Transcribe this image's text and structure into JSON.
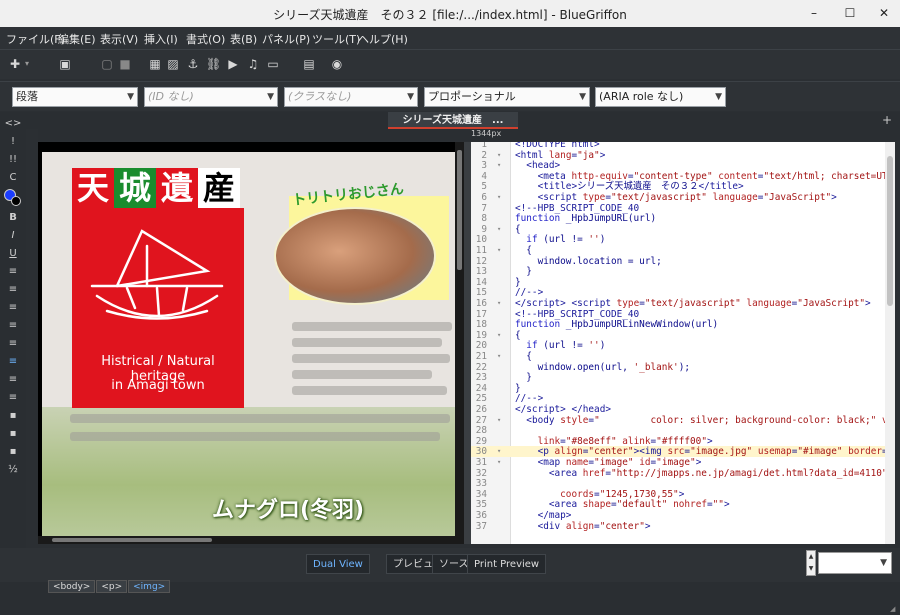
{
  "window": {
    "title": "シリーズ天城遺産　その３２ [file:/.../index.html] - BlueGriffon",
    "minimize": "–",
    "maximize": "☐",
    "close": "✕"
  },
  "menu": [
    "ファイル(F)",
    "編集(E)",
    "表示(V)",
    "挿入(I)",
    "書式(O)",
    "表(B)",
    "パネル(P)",
    "ツール(T)",
    "ヘルプ(H)"
  ],
  "toolbar_icons": [
    "plus-icon",
    "new-doc-icon",
    "doc-icon",
    "stop-icon",
    "table-icon",
    "image-icon",
    "anchor-icon",
    "link-icon",
    "video-icon",
    "audio-icon",
    "form-icon",
    "file-icon",
    "globe-icon"
  ],
  "format": {
    "paragraph": "段落",
    "id": "(ID なし)",
    "class": "(クラスなし)",
    "font": "プロポーショナル",
    "aria": "(ARIA role なし)"
  },
  "leftbar": [
    "<>",
    "!",
    "!!",
    "C",
    "",
    "B",
    "I",
    "U",
    "≡",
    "≡",
    "≡",
    "≡",
    "≡",
    "≡",
    "≡",
    "≡",
    "▪",
    "▪",
    "▪",
    "½"
  ],
  "tab": {
    "label": "シリーズ天城遺産　...",
    "plus": "+"
  },
  "ruler": {
    "label": "1344px"
  },
  "design": {
    "logo": [
      "天",
      "城",
      "遺",
      "産"
    ],
    "logo_colors": [
      "#ffffff",
      "#ffffff",
      "#ffffff",
      "#000000"
    ],
    "logo_bg": [
      "#e0141e",
      "#1a8c2e",
      "#e0141e",
      "#ffffff"
    ],
    "caption1": "Histrical / Natural heritage",
    "caption2": "in Amagi town",
    "tori": "トリトリおじさん",
    "munagro": "ムナグロ(冬羽)"
  },
  "source": {
    "lines": [
      {
        "n": "1",
        "fold": "",
        "html": "<span class=\"tag\">&lt;!DOCTYPE html&gt;</span>"
      },
      {
        "n": "2",
        "fold": "▾",
        "html": "<span class=\"tag\">&lt;html</span> <span class=\"attr\">lang</span>=<span class=\"str\">\"ja\"</span><span class=\"tag\">&gt;</span>"
      },
      {
        "n": "3",
        "fold": "▾",
        "html": "  <span class=\"tag\">&lt;head&gt;</span>"
      },
      {
        "n": "4",
        "fold": "",
        "html": "    <span class=\"tag\">&lt;meta</span> <span class=\"attr\">http-equiv</span>=<span class=\"str\">\"content-type\"</span> <span class=\"attr\">content</span>=<span class=\"str\">\"text/html; charset=UTF-8\"</span><span class=\"tag\">&gt;</span>"
      },
      {
        "n": "5",
        "fold": "",
        "html": "    <span class=\"tag\">&lt;title&gt;</span>シリーズ天城遺産　その３２<span class=\"tag\">&lt;/title&gt;</span>"
      },
      {
        "n": "6",
        "fold": "▾",
        "html": "    <span class=\"tag\">&lt;script</span> <span class=\"attr\">type</span>=<span class=\"str\">\"text/javascript\"</span> <span class=\"attr\">language</span>=<span class=\"str\">\"JavaScript\"</span><span class=\"tag\">&gt;</span>"
      },
      {
        "n": "7",
        "fold": "",
        "html": "<span class=\"tag\">&lt;!--HPB_SCRIPT_CODE_40</span>"
      },
      {
        "n": "8",
        "fold": "",
        "html": "<span class=\"kw\">function</span> _HpbJumpURL(url)"
      },
      {
        "n": "9",
        "fold": "▾",
        "html": "{"
      },
      {
        "n": "10",
        "fold": "",
        "html": "  <span class=\"kw\">if</span> (url != <span class=\"str\">''</span>)"
      },
      {
        "n": "11",
        "fold": "▾",
        "html": "  {"
      },
      {
        "n": "12",
        "fold": "",
        "html": "    window.location = url;"
      },
      {
        "n": "13",
        "fold": "",
        "html": "  }"
      },
      {
        "n": "14",
        "fold": "",
        "html": "}"
      },
      {
        "n": "15",
        "fold": "",
        "html": "<span class=\"tag\">//--&gt;</span>"
      },
      {
        "n": "16",
        "fold": "▾",
        "html": "<span class=\"tag\">&lt;/script&gt;</span> <span class=\"tag\">&lt;script</span> <span class=\"attr\">type</span>=<span class=\"str\">\"text/javascript\"</span> <span class=\"attr\">language</span>=<span class=\"str\">\"JavaScript\"</span><span class=\"tag\">&gt;</span>"
      },
      {
        "n": "17",
        "fold": "",
        "html": "<span class=\"tag\">&lt;!--HPB_SCRIPT_CODE_40</span>"
      },
      {
        "n": "18",
        "fold": "",
        "html": "<span class=\"kw\">function</span> _HpbJumpURLinNewWindow(url)"
      },
      {
        "n": "19",
        "fold": "▾",
        "html": "{"
      },
      {
        "n": "20",
        "fold": "",
        "html": "  <span class=\"kw\">if</span> (url != <span class=\"str\">''</span>)"
      },
      {
        "n": "21",
        "fold": "▾",
        "html": "  {"
      },
      {
        "n": "22",
        "fold": "",
        "html": "    window.open(url, <span class=\"str\">'_blank'</span>);"
      },
      {
        "n": "23",
        "fold": "",
        "html": "  }"
      },
      {
        "n": "24",
        "fold": "",
        "html": "}"
      },
      {
        "n": "25",
        "fold": "",
        "html": "<span class=\"tag\">//--&gt;</span>"
      },
      {
        "n": "26",
        "fold": "",
        "html": "<span class=\"tag\">&lt;/script&gt;</span> <span class=\"tag\">&lt;/head&gt;</span>"
      },
      {
        "n": "27",
        "fold": "▾",
        "html": "  <span class=\"tag\">&lt;body</span> <span class=\"attr\">style</span>=<span class=\"str\">\"         color: silver; background-color: black;\"</span> <span class=\"attr\">vlink</span>=<span class=\"str\">\"#e</span>"
      },
      {
        "n": "28",
        "fold": "",
        "html": ""
      },
      {
        "n": "29",
        "fold": "",
        "html": "    <span class=\"attr\">link</span>=<span class=\"str\">\"#8e8eff\"</span> <span class=\"attr\">alink</span>=<span class=\"str\">\"#ffff00\"</span><span class=\"tag\">&gt;</span>"
      },
      {
        "n": "30",
        "fold": "▾",
        "html": "    <span class=\"tag\">&lt;p</span> <span class=\"attr\">align</span>=<span class=\"str\">\"center\"</span><span class=\"tag\">&gt;</span><span class=\"tag\">&lt;img</span> <span class=\"attr\">src</span>=<span class=\"str\">\"image.jpg\"</span> <span class=\"attr\">usemap</span>=<span class=\"str\">\"#image\"</span> <span class=\"attr\">border</span>=<span class=\"str\">\"0\"</span><span class=\"tag\">&gt;&lt;/p</span>"
      },
      {
        "n": "31",
        "fold": "▾",
        "html": "    <span class=\"tag\">&lt;map</span> <span class=\"attr\">name</span>=<span class=\"str\">\"image\"</span> <span class=\"attr\">id</span>=<span class=\"str\">\"image\"</span><span class=\"tag\">&gt;</span>"
      },
      {
        "n": "32",
        "fold": "",
        "html": "      <span class=\"tag\">&lt;area</span> <span class=\"attr\">href</span>=<span class=\"str\">\"http://jmapps.ne.jp/amagi/det.html?data_id=4110\"</span> <span class=\"attr\">shape</span>=<span class=\"str\">\"</span>"
      },
      {
        "n": "33",
        "fold": "",
        "html": ""
      },
      {
        "n": "34",
        "fold": "",
        "html": "        <span class=\"attr\">coords</span>=<span class=\"str\">\"1245,1730,55\"</span><span class=\"tag\">&gt;</span>"
      },
      {
        "n": "35",
        "fold": "",
        "html": "      <span class=\"tag\">&lt;area</span> <span class=\"attr\">shape</span>=<span class=\"str\">\"default\"</span> <span class=\"attr\">nohref</span>=<span class=\"str\">\"\"</span><span class=\"tag\">&gt;</span>"
      },
      {
        "n": "36",
        "fold": "",
        "html": "    <span class=\"tag\">&lt;/map&gt;</span>"
      },
      {
        "n": "37",
        "fold": "",
        "html": "    <span class=\"tag\">&lt;div</span> <span class=\"attr\">align</span>=<span class=\"str\">\"center\"</span><span class=\"tag\">&gt;</span>"
      }
    ],
    "highlight_line": "30"
  },
  "views": {
    "dual": "Dual View",
    "preview": "プレビュー",
    "source": "ソース",
    "print": "Print Preview"
  },
  "breadcrumbs": [
    "<body>",
    "<p>",
    "<img>"
  ],
  "accent": "#d0402e",
  "link_blue": "#6fb5ff"
}
